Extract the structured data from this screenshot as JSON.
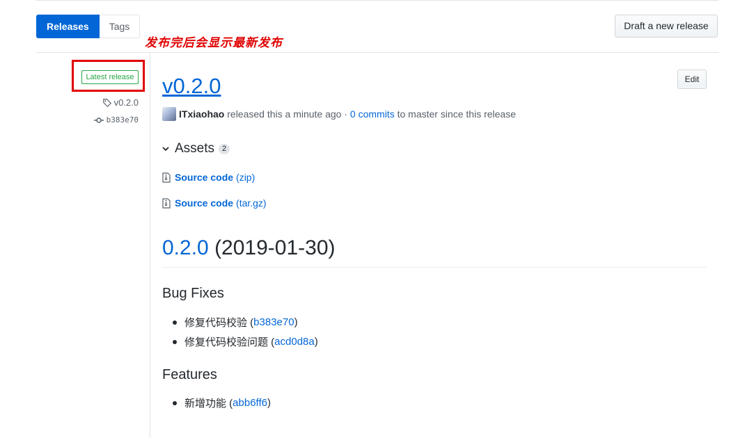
{
  "tabs": {
    "releases": "Releases",
    "tags": "Tags"
  },
  "annotation": "发布完后会显示最新发布",
  "draft_button": "Draft a new release",
  "sidebar": {
    "badge": "Latest release",
    "tag": "v0.2.0",
    "commit": "b383e70"
  },
  "release": {
    "title": "v0.2.0",
    "edit_label": "Edit",
    "author": "ITxiaohao",
    "released_text": " released this a minute ago · ",
    "commits_link": "0 commits",
    "commits_suffix": " to master since this release"
  },
  "assets": {
    "heading": "Assets",
    "count": "2",
    "items": [
      {
        "name": "Source code",
        "ext": "(zip)"
      },
      {
        "name": "Source code",
        "ext": "(tar.gz)"
      }
    ]
  },
  "notes": {
    "version": "0.2.0",
    "date": " (2019-01-30)",
    "sections": [
      {
        "heading": "Bug Fixes",
        "items": [
          {
            "text": "修复代码校验 (",
            "hash": "b383e70",
            "close": ")"
          },
          {
            "text": "修复代码校验问题 (",
            "hash": "acd0d8a",
            "close": ")"
          }
        ]
      },
      {
        "heading": "Features",
        "items": [
          {
            "text": "新增功能 (",
            "hash": "abb6ff6",
            "close": ")"
          }
        ]
      }
    ]
  },
  "colors": {
    "primary": "#0366d6",
    "success": "#28a745",
    "annotation_red": "#e00000"
  },
  "icons": {
    "tag": "tag-icon",
    "commit": "git-commit-icon",
    "chevron": "chevron-down-icon",
    "archive": "file-zip-icon"
  }
}
